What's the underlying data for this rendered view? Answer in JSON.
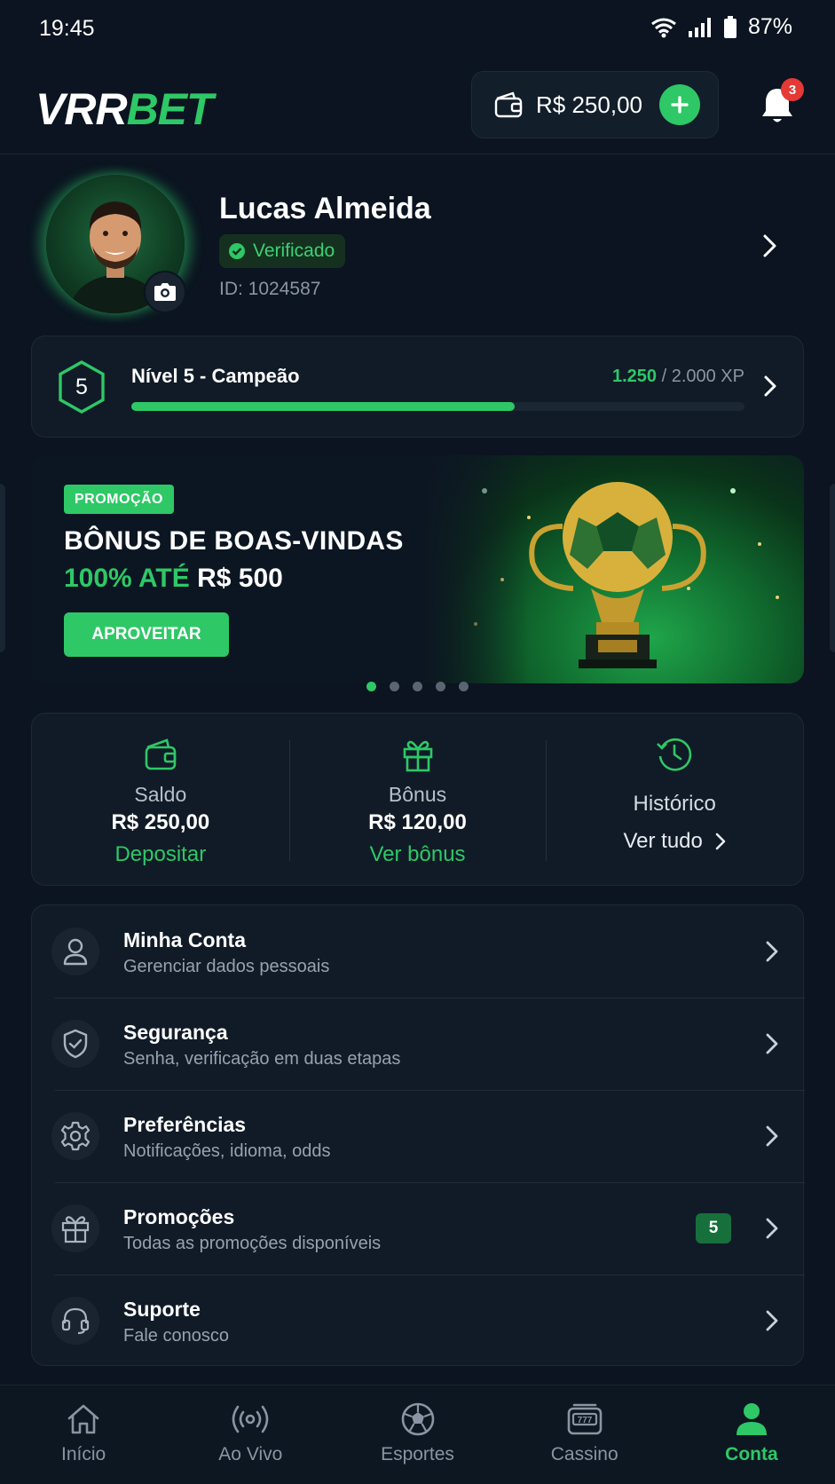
{
  "status_bar": {
    "time": "19:45",
    "battery": "87%"
  },
  "header": {
    "logo_part1": "VRR",
    "logo_part2": "BET",
    "wallet_amount": "R$ 250,00",
    "notification_count": "3"
  },
  "profile": {
    "name": "Lucas Almeida",
    "verified_label": "Verificado",
    "id_text": "ID: 1024587"
  },
  "level": {
    "number": "5",
    "title": "Nível 5 - Campeão",
    "xp_current": "1.250",
    "xp_total": " / 2.000 XP",
    "progress_fraction": 0.625
  },
  "promo": {
    "tag": "PROMOÇÃO",
    "title": "BÔNUS DE BOAS-VINDAS",
    "subtitle_green": "100% ATÉ",
    "subtitle_white": " R$ 500",
    "button": "APROVEITAR",
    "slide_count": 5,
    "active_slide": 1
  },
  "summary": {
    "balance": {
      "label": "Saldo",
      "value": "R$ 250,00",
      "link": "Depositar"
    },
    "bonus": {
      "label": "Bônus",
      "value": "R$ 120,00",
      "link": "Ver bônus"
    },
    "history": {
      "label": "Histórico",
      "link": "Ver tudo"
    }
  },
  "menu": {
    "items": [
      {
        "title": "Minha Conta",
        "subtitle": "Gerenciar dados pessoais",
        "icon": "user-icon"
      },
      {
        "title": "Segurança",
        "subtitle": "Senha, verificação em duas etapas",
        "icon": "shield-icon"
      },
      {
        "title": "Preferências",
        "subtitle": "Notificações, idioma, odds",
        "icon": "gear-icon"
      },
      {
        "title": "Promoções",
        "subtitle": "Todas as promoções disponíveis",
        "icon": "gift-icon",
        "badge": "5"
      },
      {
        "title": "Suporte",
        "subtitle": "Fale conosco",
        "icon": "headset-icon"
      }
    ]
  },
  "bottom_nav": {
    "items": [
      {
        "label": "Início",
        "icon": "home-icon"
      },
      {
        "label": "Ao Vivo",
        "icon": "live-icon"
      },
      {
        "label": "Esportes",
        "icon": "soccer-ball-icon"
      },
      {
        "label": "Cassino",
        "icon": "slot-machine-icon"
      },
      {
        "label": "Conta",
        "icon": "user-icon",
        "active": true
      }
    ]
  },
  "colors": {
    "accent": "#2ec866",
    "background": "#0b1420",
    "card": "#111b27",
    "badge_red": "#e53935"
  }
}
